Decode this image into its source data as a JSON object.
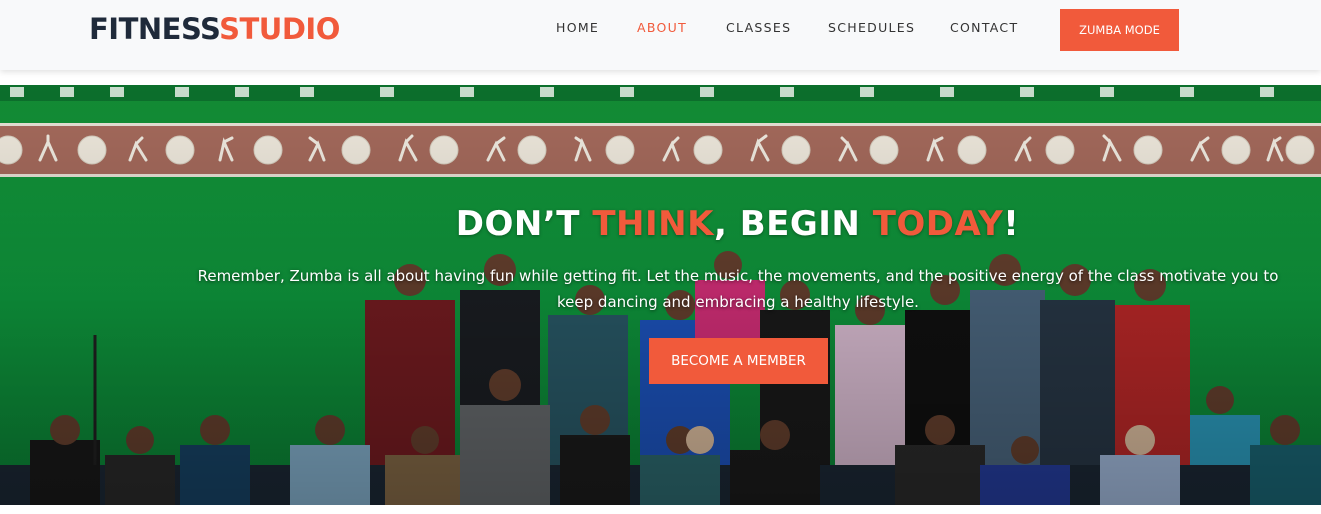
{
  "brand": {
    "part1": "FITNESS",
    "part2": "STUDIO"
  },
  "nav": {
    "items": [
      {
        "label": "HOME"
      },
      {
        "label": "ABOUT"
      },
      {
        "label": "CLASSES"
      },
      {
        "label": "SCHEDULES"
      },
      {
        "label": "CONTACT"
      }
    ],
    "active": "ABOUT",
    "cta_label": "ZUMBA MODE"
  },
  "hero": {
    "title": {
      "w1": "DON’T ",
      "w2": "THINK",
      "w3": ", BEGIN ",
      "w4": "TODAY",
      "w5": "!"
    },
    "subtitle": "Remember, Zumba is all about having fun while getting fit. Let the music, the movements, and the positive energy of the class motivate you to keep dancing and embracing a healthy lifestyle.",
    "button_label": "BECOME A MEMBER",
    "background": "group-photo-green-wall"
  },
  "colors": {
    "accent": "#f15a3b",
    "brand_dark": "#1f2a3a",
    "header_bg": "#f8f9fa",
    "hero_green": "#0f9a3b"
  }
}
